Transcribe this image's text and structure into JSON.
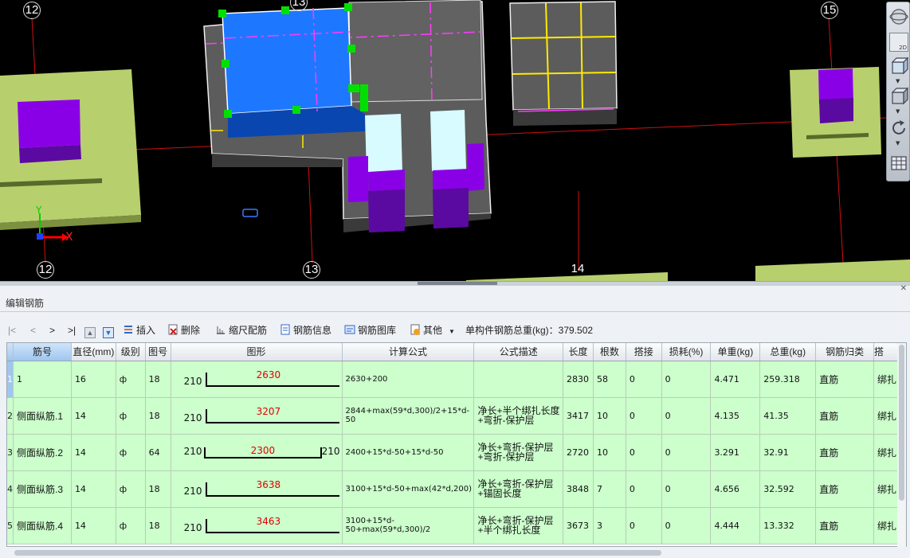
{
  "axes": {
    "top_left": "12",
    "top_mid": "13",
    "top_right": "15",
    "bottom_left": "12",
    "bottom_mid": "13",
    "bottom_right": "14"
  },
  "coord_labels": {
    "x": "X",
    "y": "Y"
  },
  "view_toolbar": {
    "view_2d_label": "2D"
  },
  "panel": {
    "title": "编辑钢筋"
  },
  "toolbar": {
    "first": "|<",
    "prev": "<",
    "next": ">",
    "last": ">|",
    "insert": "插入",
    "delete": "删除",
    "scale_rebar": "缩尺配筋",
    "rebar_info": "钢筋信息",
    "rebar_library": "钢筋图库",
    "other": "其他",
    "total_weight": "单构件钢筋总重(kg)：379.502"
  },
  "table": {
    "headers": [
      "筋号",
      "直径(mm)",
      "级别",
      "图号",
      "图形",
      "计算公式",
      "公式描述",
      "长度",
      "根数",
      "搭接",
      "损耗(%)",
      "单重(kg)",
      "总重(kg)",
      "钢筋归类",
      "搭"
    ],
    "rows": [
      {
        "num": "1",
        "name": "1",
        "diameter": "16",
        "grade": "ф",
        "fig": "18",
        "shape_left": "210",
        "shape_mid": "2630",
        "shape_right": "",
        "formula": "2630+200",
        "desc": "",
        "length": "2830",
        "count": "58",
        "lap": "0",
        "loss": "0",
        "unit_w": "4.471",
        "total_w": "259.318",
        "category": "直筋",
        "lap_type": "绑扎"
      },
      {
        "num": "2",
        "name": "侧面纵筋.1",
        "diameter": "14",
        "grade": "ф",
        "fig": "18",
        "shape_left": "210",
        "shape_mid": "3207",
        "shape_right": "",
        "formula": "2844+max(59*d,300)/2+15*d-50",
        "desc": "净长+半个绑扎长度+弯折-保护层",
        "length": "3417",
        "count": "10",
        "lap": "0",
        "loss": "0",
        "unit_w": "4.135",
        "total_w": "41.35",
        "category": "直筋",
        "lap_type": "绑扎"
      },
      {
        "num": "3",
        "name": "侧面纵筋.2",
        "diameter": "14",
        "grade": "ф",
        "fig": "64",
        "shape_left": "210",
        "shape_mid": "2300",
        "shape_right": "210",
        "formula": "2400+15*d-50+15*d-50",
        "desc": "净长+弯折-保护层+弯折-保护层",
        "length": "2720",
        "count": "10",
        "lap": "0",
        "loss": "0",
        "unit_w": "3.291",
        "total_w": "32.91",
        "category": "直筋",
        "lap_type": "绑扎"
      },
      {
        "num": "4",
        "name": "侧面纵筋.3",
        "diameter": "14",
        "grade": "ф",
        "fig": "18",
        "shape_left": "210",
        "shape_mid": "3638",
        "shape_right": "",
        "formula": "3100+15*d-50+max(42*d,200)",
        "desc": "净长+弯折-保护层+锚固长度",
        "length": "3848",
        "count": "7",
        "lap": "0",
        "loss": "0",
        "unit_w": "4.656",
        "total_w": "32.592",
        "category": "直筋",
        "lap_type": "绑扎"
      },
      {
        "num": "5",
        "name": "侧面纵筋.4",
        "diameter": "14",
        "grade": "ф",
        "fig": "18",
        "shape_left": "210",
        "shape_mid": "3463",
        "shape_right": "",
        "formula": "3100+15*d-50+max(59*d,300)/2",
        "desc": "净长+弯折-保护层+半个绑扎长度",
        "length": "3673",
        "count": "3",
        "lap": "0",
        "loss": "0",
        "unit_w": "4.444",
        "total_w": "13.332",
        "category": "直筋",
        "lap_type": "绑扎"
      }
    ]
  },
  "colors": {
    "selection_blue": "#1e78ff",
    "grip_green": "#00e000",
    "slab_yellowgreen": "#b8cf6e",
    "column_purple": "#8a00e6",
    "grid_red": "#d01010",
    "row_green": "#ccffcc"
  }
}
